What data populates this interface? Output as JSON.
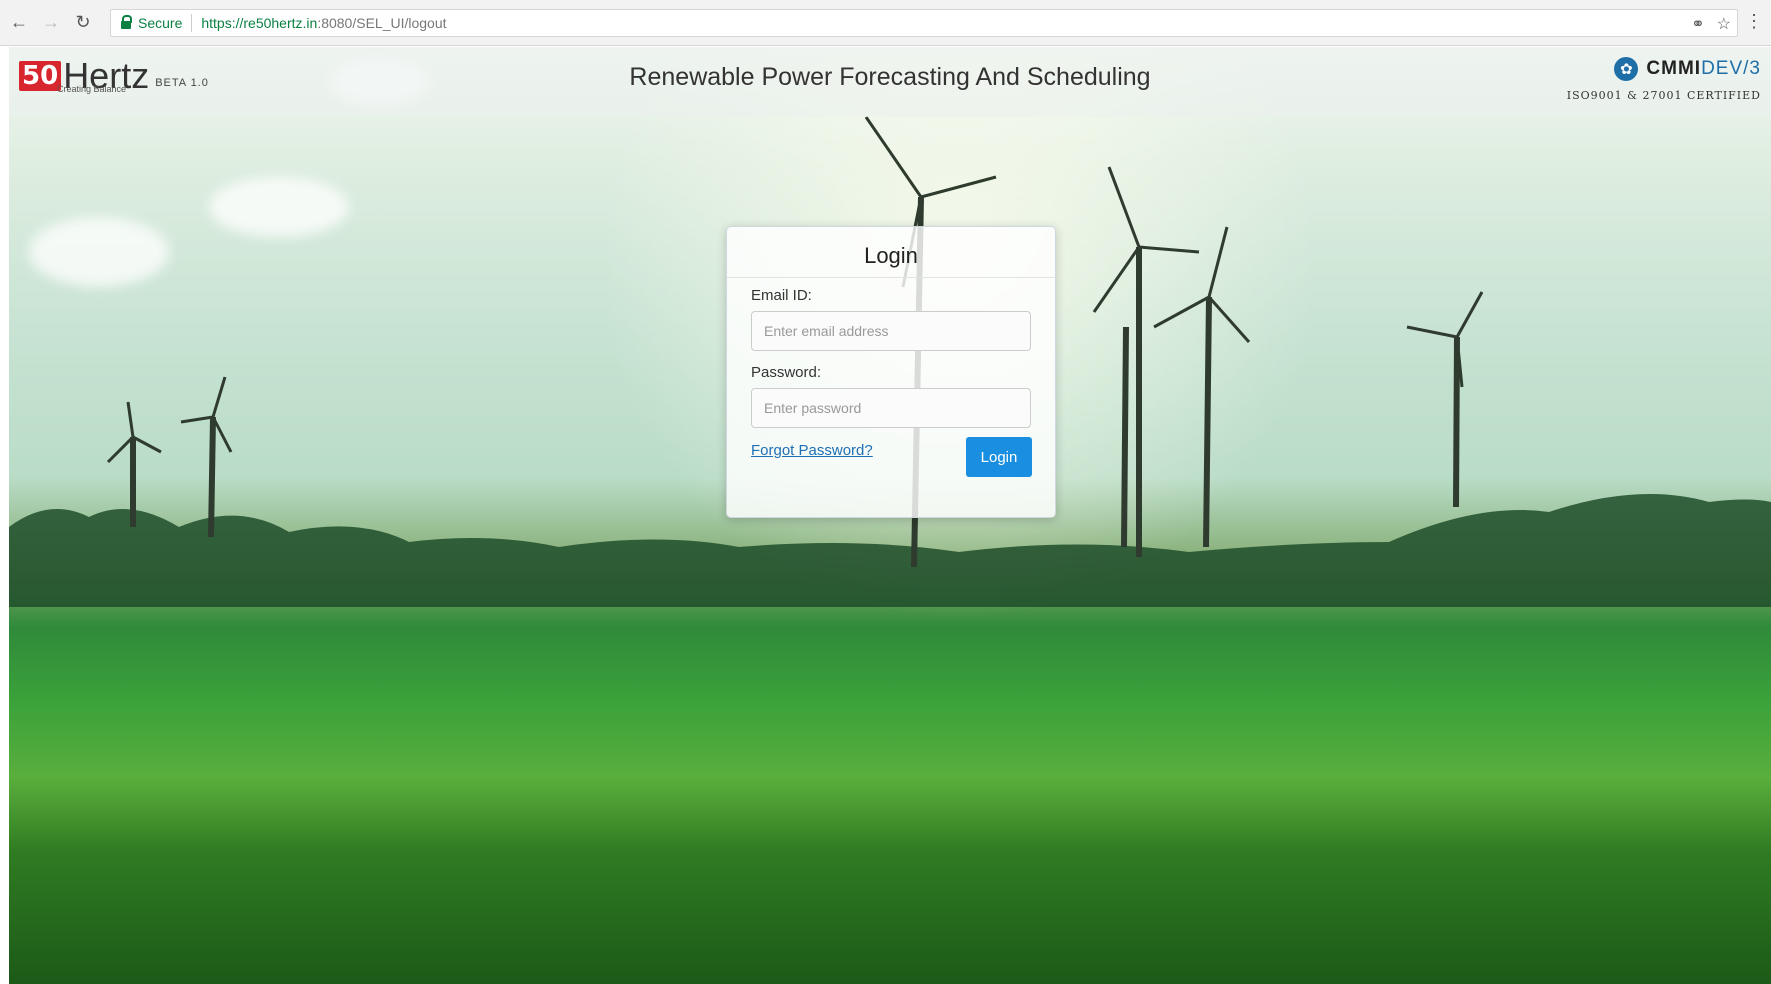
{
  "browser": {
    "secure_label": "Secure",
    "url_host": "https://re50hertz.in",
    "url_rest": ":8080/SEL_UI/logout",
    "icons": [
      "back-icon",
      "forward-icon",
      "reload-icon",
      "lock-icon",
      "key-icon",
      "star-icon",
      "menu-icon"
    ]
  },
  "header": {
    "logo_mark": "50",
    "logo_word": "Hertz",
    "logo_beta": "BETA 1.0",
    "logo_tagline": "Creating Balance",
    "title": "Renewable Power Forecasting And Scheduling",
    "cmmi_bold": "CMMI",
    "cmmi_rest": "DEV/3",
    "certification": "ISO9001 & 27001 CERTIFIED"
  },
  "login": {
    "title": "Login",
    "email_label": "Email ID:",
    "email_placeholder": "Enter email address",
    "email_value": "",
    "password_label": "Password:",
    "password_placeholder": "Enter password",
    "password_value": "",
    "forgot_label": "Forgot Password?",
    "submit_label": "Login"
  },
  "colors": {
    "accent": "#1a8ee0",
    "logo_red": "#d7262e",
    "secure_green": "#0b8043"
  }
}
